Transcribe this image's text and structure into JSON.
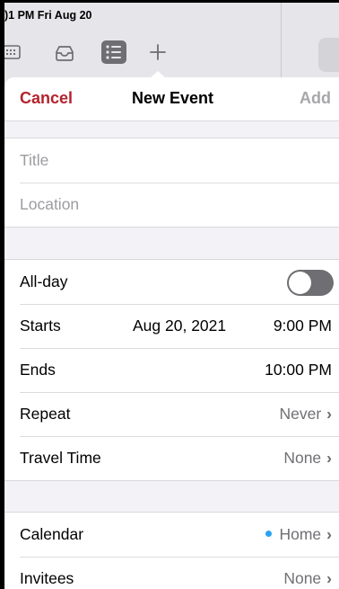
{
  "status_bar": {
    "time_date": ")1 PM  Fri Aug 20"
  },
  "toolbar": {
    "icons": [
      "calendar-grid-icon",
      "inbox-icon",
      "list-icon",
      "plus-icon"
    ]
  },
  "nav": {
    "cancel_label": "Cancel",
    "title": "New Event",
    "add_label": "Add"
  },
  "fields": {
    "title_placeholder": "Title",
    "location_placeholder": "Location"
  },
  "options": {
    "all_day_label": "All-day",
    "all_day_on": false,
    "starts_label": "Starts",
    "starts_date": "Aug 20, 2021",
    "starts_time": "9:00 PM",
    "ends_label": "Ends",
    "ends_time": "10:00 PM",
    "repeat_label": "Repeat",
    "repeat_value": "Never",
    "travel_label": "Travel Time",
    "travel_value": "None"
  },
  "more": {
    "calendar_label": "Calendar",
    "calendar_value": "Home",
    "calendar_color": "#2aa2f2",
    "invitees_label": "Invitees",
    "invitees_value": "None"
  },
  "colors": {
    "accent": "#b3232d"
  }
}
